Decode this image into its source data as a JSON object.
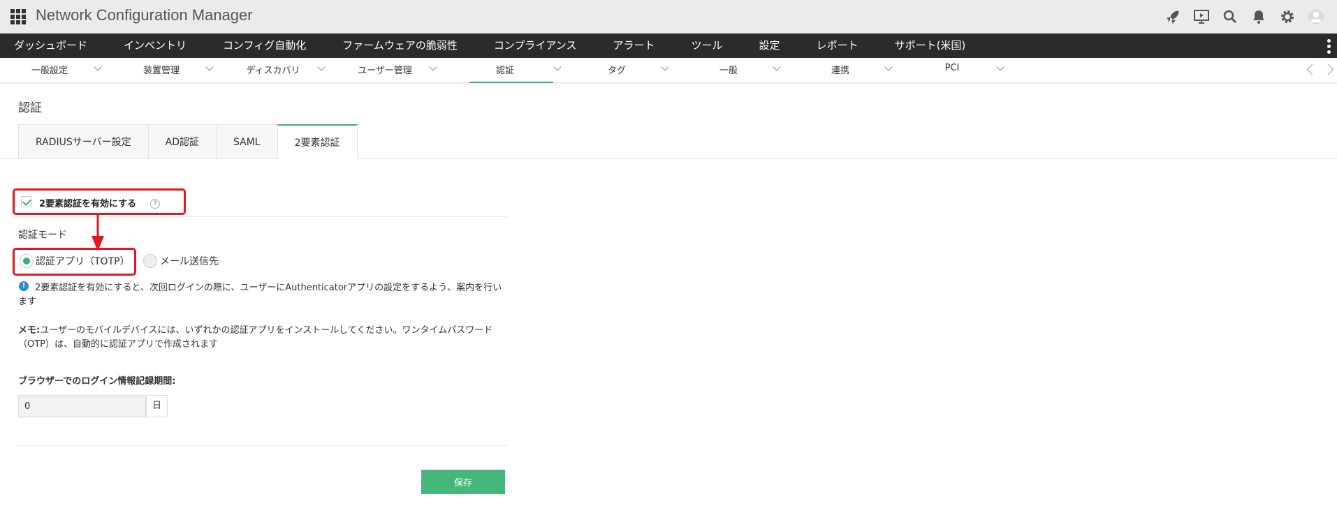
{
  "app": {
    "title": "Network Configuration Manager"
  },
  "top_icons": [
    "rocket-icon",
    "presentation-icon",
    "search-icon",
    "bell-icon",
    "gear-icon",
    "user-avatar-icon"
  ],
  "main_nav": [
    "ダッシュボード",
    "インベントリ",
    "コンフィグ自動化",
    "ファームウェアの脆弱性",
    "コンプライアンス",
    "アラート",
    "ツール",
    "設定",
    "レポート",
    "サポート(米国)"
  ],
  "sub_nav": [
    {
      "label": "一般設定"
    },
    {
      "label": "装置管理"
    },
    {
      "label": "ディスカバリ"
    },
    {
      "label": "ユーザー管理"
    },
    {
      "label": "認証",
      "active": true
    },
    {
      "label": "タグ"
    },
    {
      "label": "一般"
    },
    {
      "label": "連携"
    },
    {
      "label": "PCI"
    }
  ],
  "page": {
    "title": "認証"
  },
  "tabs": [
    {
      "label": "RADIUSサーバー設定"
    },
    {
      "label": "AD認証"
    },
    {
      "label": "SAML"
    },
    {
      "label": "2要素認証",
      "active": true
    }
  ],
  "two_factor": {
    "enable_label": "2要素認証を有効にする",
    "enabled": true,
    "help": "?",
    "mode_label": "認証モード",
    "modes": [
      {
        "label": "認証アプリ（TOTP）",
        "selected": true
      },
      {
        "label": "メール送信先",
        "selected": false
      }
    ],
    "info_text": "2要素認証を有効にすると、次回ログインの際に、ユーザーにAuthenticatorアプリの設定をするよう、案内を行います",
    "memo_prefix": "メモ:",
    "memo_text": "ユーザーのモバイルデバイスには、いずれかの認証アプリをインストールしてください。ワンタイムパスワード（OTP）は、自動的に認証アプリで作成されます",
    "period_label": "ブラウザーでのログイン情報記録期間:",
    "period_value": "0",
    "period_unit": "日",
    "save_label": "保存"
  },
  "colors": {
    "accent": "#3ab07a",
    "highlight": "#e3171f",
    "nav_bg": "#2b2b2b",
    "topbar_bg": "#ebebeb"
  }
}
